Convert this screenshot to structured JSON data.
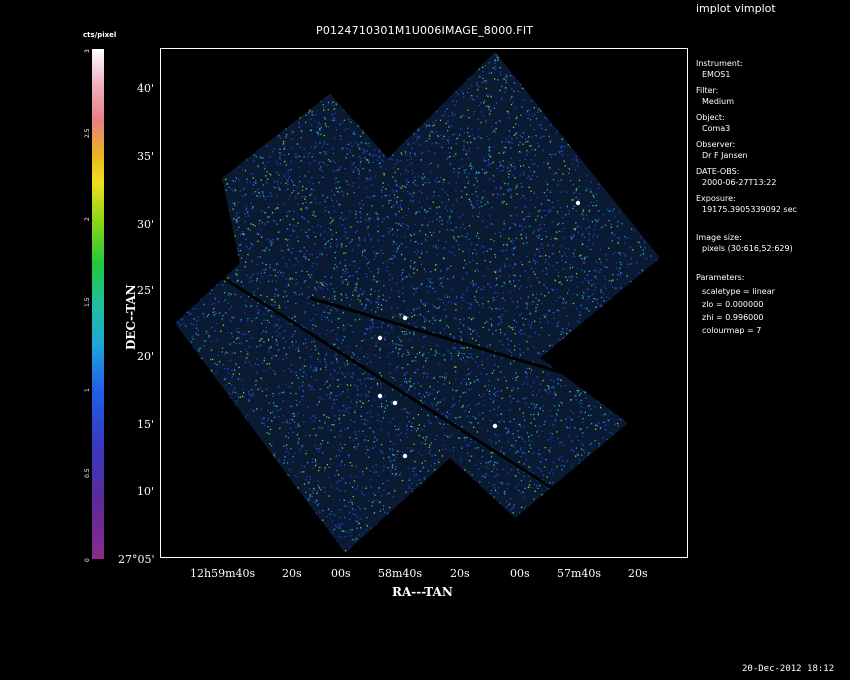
{
  "app_title": "implot vimplot",
  "plot_title": "P0124710301M1U006IMAGE_8000.FIT",
  "timestamp": "20-Dec-2012 18:12",
  "colorbar": {
    "unit": "cts/pixel",
    "ticks": [
      "0",
      "0.5",
      "1",
      "1.5",
      "2",
      "2.5",
      "3"
    ],
    "range": [
      0,
      3
    ]
  },
  "axes": {
    "ylabel": "DEC--TAN",
    "xlabel": "RA---TAN",
    "yticks": [
      "40'",
      "35'",
      "30'",
      "25'",
      "20'",
      "15'",
      "10'",
      "27°05'"
    ],
    "xticks": [
      "12h59m40s",
      "20s",
      "00s",
      "58m40s",
      "20s",
      "00s",
      "57m40s",
      "20s"
    ]
  },
  "info": {
    "instrument_label": "Instrument:",
    "instrument": "EMOS1",
    "filter_label": "Filter:",
    "filter": "Medium",
    "object_label": "Object:",
    "object": "Coma3",
    "observer_label": "Observer:",
    "observer": "Dr F Jansen",
    "date_label": "DATE-OBS:",
    "date": "2000-06-27T13:22",
    "exposure_label": "Exposure:",
    "exposure": "19175.3905339092 sec",
    "imgsize_label": "Image size:",
    "imgsize": "pixels (30:616,52:629)",
    "params_label": "Parameters:",
    "scaletype": "scaletype = linear",
    "zlo": "zlo = 0.000000",
    "zhi": "zhi = 0.996000",
    "colourmap": "colourmap =   7"
  }
}
